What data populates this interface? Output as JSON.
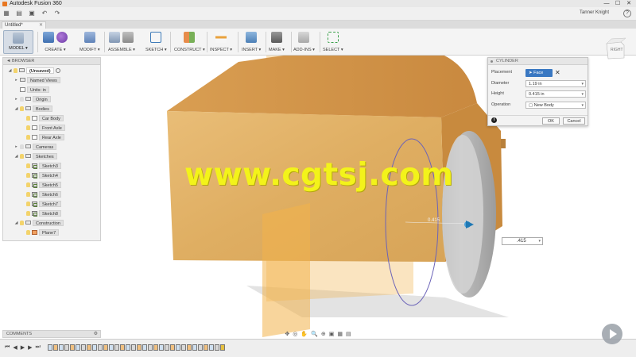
{
  "window": {
    "title": "Autodesk Fusion 360",
    "controls": [
      "—",
      "☐",
      "✕"
    ]
  },
  "quick_access": {
    "user_name": "Tanner Knight",
    "help": "?"
  },
  "document_tab": {
    "label": "Untitled*",
    "close": "✕"
  },
  "ribbon": {
    "workspace": "MODEL ▾",
    "groups": [
      {
        "id": "create",
        "label": "CREATE ▾"
      },
      {
        "id": "modify",
        "label": "MODIFY ▾"
      },
      {
        "id": "assemble",
        "label": "ASSEMBLE ▾"
      },
      {
        "id": "sketch",
        "label": "SKETCH ▾"
      },
      {
        "id": "construct",
        "label": "CONSTRUCT ▾"
      },
      {
        "id": "inspect",
        "label": "INSPECT ▾"
      },
      {
        "id": "insert",
        "label": "INSERT ▾"
      },
      {
        "id": "make",
        "label": "MAKE ▾"
      },
      {
        "id": "addins",
        "label": "ADD-INS ▾"
      },
      {
        "id": "select",
        "label": "SELECT ▾"
      }
    ]
  },
  "browser": {
    "header": "◄ BROWSER",
    "root": "(Unsaved)",
    "named_views": "Named Views",
    "units": "Units: in",
    "origin": "Origin",
    "bodies": "Bodies",
    "body_items": [
      "Car Body",
      "Front Axle",
      "Rear Axle"
    ],
    "cameras": "Cameras",
    "sketches": "Sketches",
    "sketch_items": [
      "Sketch3",
      "Sketch4",
      "Sketch5",
      "Sketch6",
      "Sketch7",
      "Sketch8"
    ],
    "construction": "Construction",
    "construction_items": [
      "Plane7"
    ]
  },
  "cylinder_dialog": {
    "title": "CYLINDER",
    "placement_label": "Placement",
    "placement_value": "Face",
    "diameter_label": "Diameter",
    "diameter_value": "1.19 in",
    "height_label": "Height",
    "height_value": "0.415 in",
    "operation_label": "Operation",
    "operation_value": "New Body",
    "ok_label": "OK",
    "cancel_label": "Cancel"
  },
  "viewcube": {
    "face_label": "RIGHT"
  },
  "viewport": {
    "dimension_label": "0.415",
    "value_input": ".415",
    "watermark": "www.cgtsj.com"
  },
  "comments": {
    "label": "COMMENTS"
  },
  "colors": {
    "wood_light": "#e6b870",
    "wood_dark": "#c98f44",
    "plane_orange": "#f2b24a",
    "wheel_gray": "#b9b9b9",
    "select_blue": "#3a78c2",
    "watermark_yellow": "#f3f31a"
  }
}
